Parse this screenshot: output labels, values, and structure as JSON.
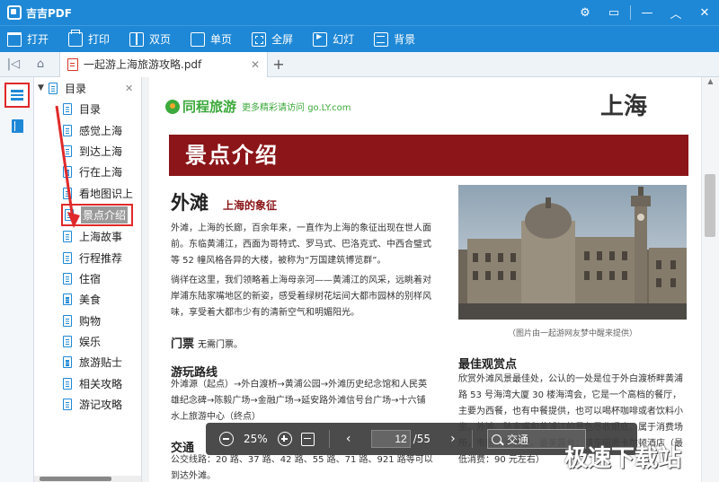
{
  "app": {
    "name": "吉吉PDF"
  },
  "titlebar": {
    "icons": [
      "settings-icon",
      "feedback-icon",
      "minimize-icon",
      "collapse-icon",
      "close-icon"
    ]
  },
  "toolbar": {
    "open": "打开",
    "print": "打印",
    "double_page": "双页",
    "single_page": "单页",
    "fullscreen": "全屏",
    "slideshow": "幻灯",
    "background": "背景"
  },
  "tabs": {
    "active_file": "一起游上海旅游攻略.pdf",
    "add": "+"
  },
  "outline": {
    "title": "目录",
    "items": [
      "目录",
      "感觉上海",
      "到达上海",
      "行在上海",
      "看地图识上",
      "景点介绍",
      "上海故事",
      "行程推荐",
      "住宿",
      "美食",
      "购物",
      "娱乐",
      "旅游贴士",
      "相关攻略",
      "游记攻略"
    ],
    "selected": "景点介绍"
  },
  "document": {
    "brand_name": "同程旅游",
    "brand_slogan": "更多精彩请访问 go.LY.com",
    "city": "上海",
    "banner": "景点介绍",
    "heading": "外滩",
    "subheading": "上海的象征",
    "para1": "外滩，上海的长廊，百余年来，一直作为上海的象征出现在世人面前。东临黄浦江，西面为哥特式、罗马式、巴洛克式、中西合璧式等 52 幢风格各异的大楼，被称为“万国建筑博览群”。",
    "para2": "徜徉在这里，我们领略着上海母亲河——黄浦江的风采，远眺着对岸浦东陆家嘴地区的新姿，感受着绿树花坛间大都市园林的别样风味，享受着大都市少有的清新空气和明媚阳光。",
    "ticket_label": "门票",
    "ticket_value": "无需门票。",
    "route_title": "游玩路线",
    "route_text": "外滩源（起点）→外白渡桥→黄浦公园→外滩历史纪念馆和人民英雄纪念碑→陈毅广场→金融广场→延安路外滩信号台广场→十六铺水上旅游中心（终点）",
    "transport_title": "交通",
    "transport_text": "公交线路：20 路、37 路、42 路、55 路、71 路、921 路等可以到达外滩。",
    "photo_caption": "（图片由一起游网友梦中醒来提供）",
    "best_view_title": "最佳观赏点",
    "best_view_text": "欣赏外滩风景最佳处，公认的一处是位于外白渡桥畔黄浦路 53 号海湾大厦 30 楼海湾会，它是一个高档的餐厅，主要为西餐，也有中餐提供，也可以喝杯咖啡或者饮料小坐。外滩、陆家嘴和黄浦江的景色尽收眼底。属于消费场所，市民、游客量。最美露台：浦东丽思卡尔顿酒店（最低消费：90 元左右）"
  },
  "viewer": {
    "zoom": "25%",
    "current_page": "12",
    "total_pages": "/55",
    "search_value": "交通"
  },
  "watermark": "极速下载站",
  "colors": {
    "accent": "#1e88d6",
    "banner": "#8b1518",
    "brand": "#3ca93b",
    "highlight": "#e0292a"
  }
}
